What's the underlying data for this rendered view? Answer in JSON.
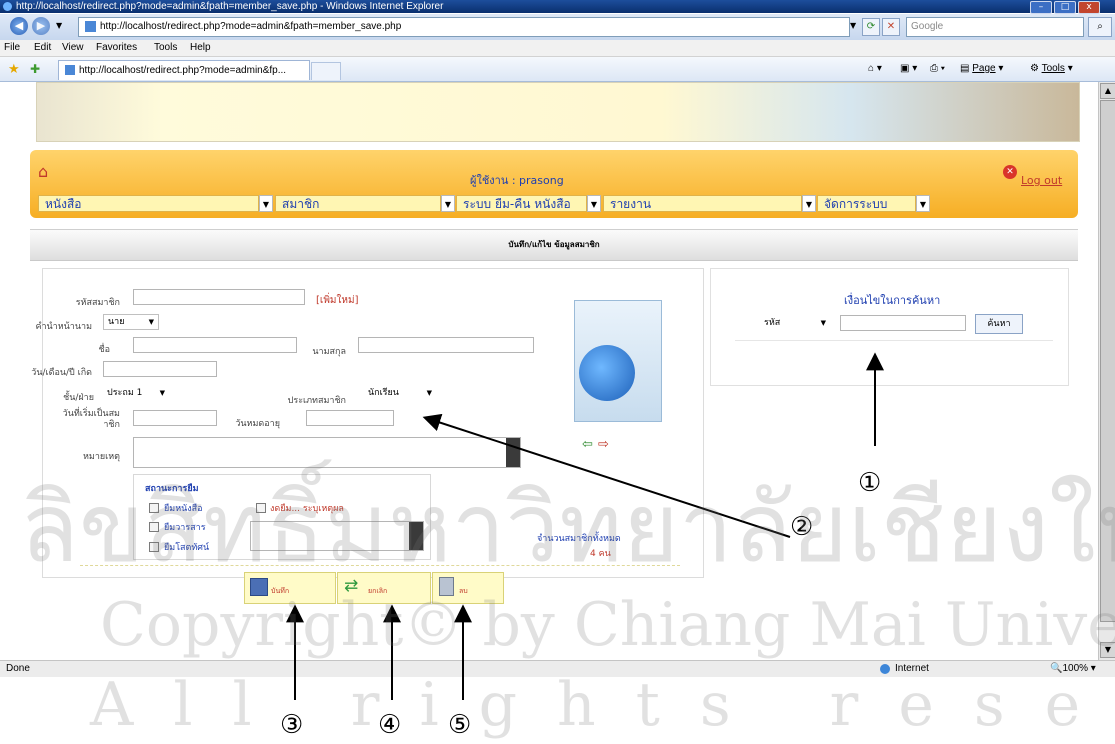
{
  "window": {
    "title": "http://localhost/redirect.php?mode=admin&fpath=member_save.php - Windows Internet Explorer",
    "address": "http://localhost/redirect.php?mode=admin&fpath=member_save.php",
    "search_placeholder": "Google",
    "tab_title": "http://localhost/redirect.php?mode=admin&fp...",
    "menu": [
      "File",
      "Edit",
      "View",
      "Favorites",
      "Tools",
      "Help"
    ],
    "command_page": "Page",
    "command_tools": "Tools",
    "min": "–",
    "max": "□",
    "close": "x"
  },
  "header": {
    "user_label": "ผู้ใช้งาน : prasong",
    "logout": "Log out",
    "menus": [
      "หนังสือ",
      "สมาชิก",
      "ระบบ ยืม-คืน หนังสือ",
      "รายงาน",
      "จัดการระบบ"
    ]
  },
  "section_title": "บันทึก/แก้ไข ข้อมูลสมาชิก",
  "form": {
    "member_id_label": "รหัสสมาชิก",
    "new_tag": "[เพิ่มใหม่]",
    "prefix_label": "คำนำหน้านาม",
    "prefix_value": "นาย",
    "first_name_label": "ชื่อ",
    "last_name_label": "นามสกุล",
    "birthdate_label": "วัน/เดือน/ปี เกิด",
    "class_label": "ชั้น/ฝ่าย",
    "class_value": "ประถม 1",
    "member_type_label": "ประเภทสมาชิก",
    "member_type_value": "นักเรียน",
    "start_date_label_1": "วันที่เริ่มเป็นสม",
    "start_date_label_2": "าชิก",
    "expire_label": "วันหมดอายุ",
    "note_label": "หมายเหตุ",
    "status_title": "สถานะการยืม",
    "borrow_book": "ยืมหนังสือ",
    "borrow_journal": "ยืมวารสาร",
    "borrow_av": "ยืมโสตทัศน์",
    "suspend": "งดยืม... ระบุเหตุผล",
    "total_label": "จำนวนสมาชิกทั้งหมด",
    "total_value": "4 คน"
  },
  "buttons": {
    "save": "บันทึก",
    "cancel": "ยกเลิก",
    "delete": "ลบ"
  },
  "search": {
    "title": "เงื่อนไขในการค้นหา",
    "field": "รหัส",
    "button": "ค้นหา"
  },
  "status": {
    "left": "Done",
    "zone": "Internet",
    "zoom": "100%"
  },
  "callouts": [
    "①",
    "②",
    "③",
    "④",
    "⑤"
  ],
  "watermark": {
    "line1": "ลิขสิทธิ์มหาวิทยาลัยเชียงใหม่",
    "line2": "Copyright© by Chiang Mai University",
    "line3": "All rights reserved"
  }
}
